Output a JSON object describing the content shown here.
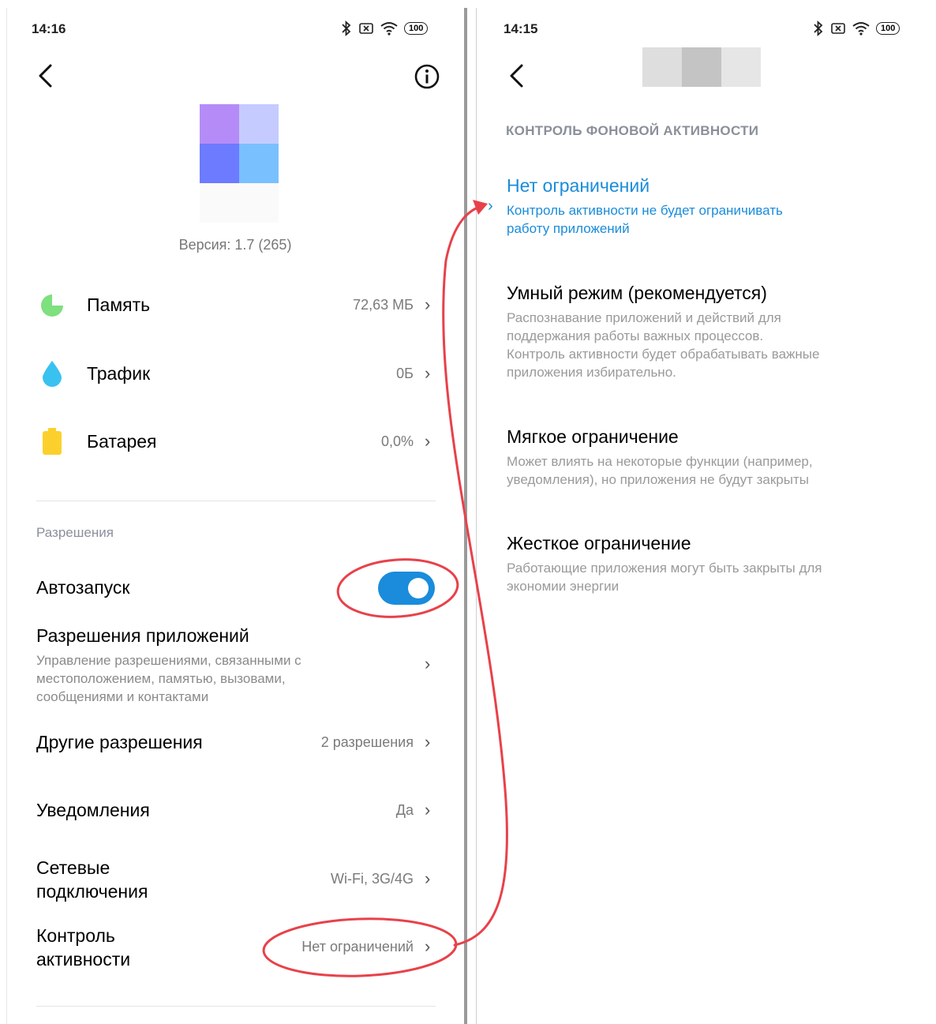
{
  "left": {
    "status": {
      "time": "14:16",
      "battery": "100"
    },
    "version": "Версия: 1.7 (265)",
    "usage": [
      {
        "label": "Память",
        "value": "72,63 МБ"
      },
      {
        "label": "Трафик",
        "value": "0Б"
      },
      {
        "label": "Батарея",
        "value": "0,0%"
      }
    ],
    "permissions_header": "Разрешения",
    "autostart": {
      "label": "Автозапуск",
      "enabled": true
    },
    "app_permissions": {
      "title": "Разрешения приложений",
      "desc": "Управление разрешениями, связанными с местоположением, памятью, вызовами, сообщениями и контактами"
    },
    "other_permissions": {
      "label": "Другие разрешения",
      "value": "2 разрешения"
    },
    "notifications": {
      "label": "Уведомления",
      "value": "Да"
    },
    "network": {
      "label_line1": "Сетевые",
      "label_line2": "подключения",
      "value": "Wi-Fi, 3G/4G"
    },
    "activity": {
      "label_line1": "Контроль",
      "label_line2": "активности",
      "value": "Нет ограничений"
    }
  },
  "right": {
    "status": {
      "time": "14:15",
      "battery": "100"
    },
    "section_header": "КОНТРОЛЬ ФОНОВОЙ АКТИВНОСТИ",
    "options": [
      {
        "title": "Нет ограничений",
        "desc_line1": "Контроль активности не будет ограничивать",
        "desc_line2": "работу приложений",
        "selected": true
      },
      {
        "title": "Умный режим (рекомендуется)",
        "desc_line1": "Распознавание приложений и действий для",
        "desc_line2": "поддержания работы важных процессов.",
        "desc_line3": "Контроль активности будет обрабатывать важные",
        "desc_line4": "приложения избирательно."
      },
      {
        "title": "Мягкое ограничение",
        "desc_line1": "Может влиять на некоторые функции (например,",
        "desc_line2": "уведомления), но приложения не будут закрыты"
      },
      {
        "title": "Жесткое ограничение",
        "desc_line1": "Работающие приложения могут быть закрыты для",
        "desc_line2": "экономии энергии"
      }
    ]
  },
  "colors": {
    "accent": "#1a8cdb",
    "toggle_on": "#1a8cdb",
    "annotation": "#e8414a"
  },
  "icons": [
    "back-icon",
    "info-icon",
    "pie-chart-icon",
    "droplet-icon",
    "battery-icon",
    "chevron-right-icon",
    "bluetooth-icon",
    "wifi-icon"
  ]
}
